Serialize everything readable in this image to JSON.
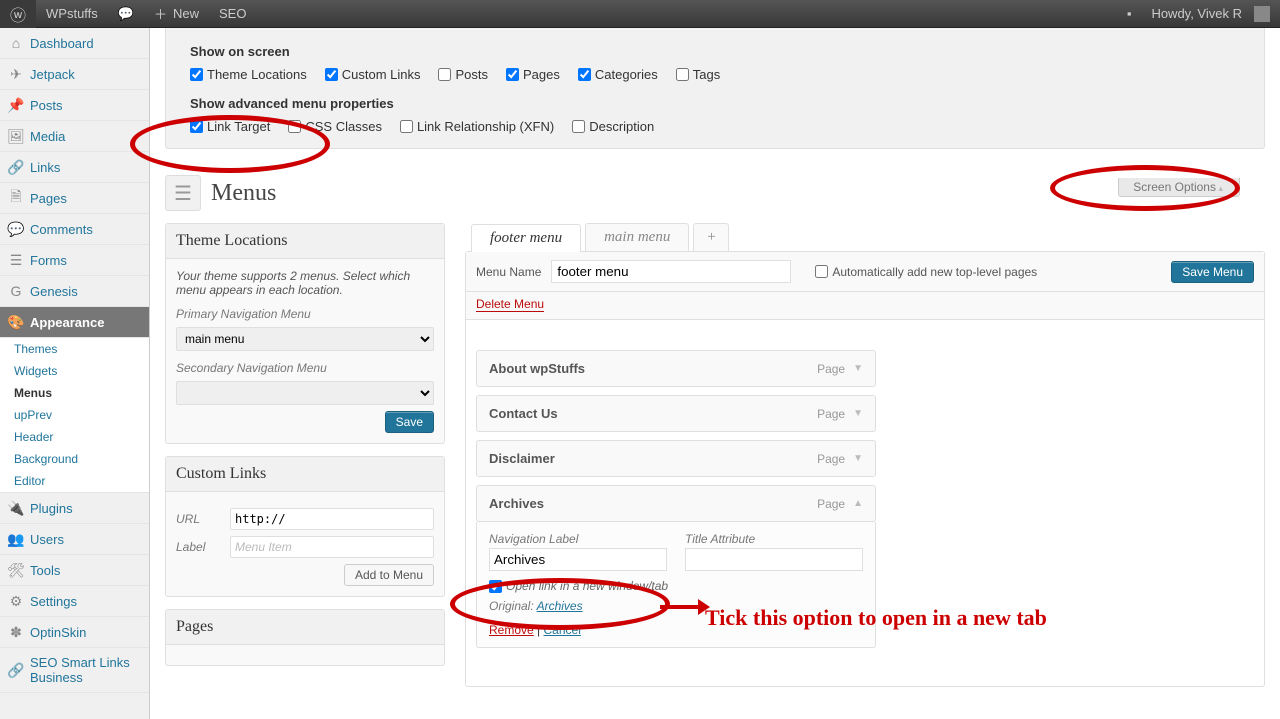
{
  "adminbar": {
    "site": "WPstuffs",
    "new": "New",
    "seo": "SEO",
    "howdy": "Howdy, Vivek R"
  },
  "sidebar": {
    "items": [
      {
        "label": "Dashboard",
        "icon": "⌂"
      },
      {
        "label": "Jetpack",
        "icon": "✈"
      },
      {
        "label": "Posts",
        "icon": "📌"
      },
      {
        "label": "Media",
        "icon": "🖼"
      },
      {
        "label": "Links",
        "icon": "🔗"
      },
      {
        "label": "Pages",
        "icon": "🗎"
      },
      {
        "label": "Comments",
        "icon": "💬"
      },
      {
        "label": "Forms",
        "icon": "☰"
      },
      {
        "label": "Genesis",
        "icon": "G"
      },
      {
        "label": "Appearance",
        "icon": "🎨",
        "current": true
      },
      {
        "label": "Plugins",
        "icon": "🔌"
      },
      {
        "label": "Users",
        "icon": "👥"
      },
      {
        "label": "Tools",
        "icon": "🛠"
      },
      {
        "label": "Settings",
        "icon": "⚙"
      },
      {
        "label": "OptinSkin",
        "icon": "✽"
      },
      {
        "label": "SEO Smart Links Business",
        "icon": "🔗"
      }
    ],
    "submenu": [
      "Themes",
      "Widgets",
      "Menus",
      "upPrev",
      "Header",
      "Background",
      "Editor"
    ]
  },
  "screenOptions": {
    "screenOptsBtn": "Screen Options",
    "showOnScreen": "Show on screen",
    "boxes": [
      {
        "label": "Theme Locations",
        "checked": true
      },
      {
        "label": "Custom Links",
        "checked": true
      },
      {
        "label": "Posts",
        "checked": false
      },
      {
        "label": "Pages",
        "checked": true
      },
      {
        "label": "Categories",
        "checked": true
      },
      {
        "label": "Tags",
        "checked": false
      }
    ],
    "advHeading": "Show advanced menu properties",
    "adv": [
      {
        "label": "Link Target",
        "checked": true
      },
      {
        "label": "CSS Classes",
        "checked": false
      },
      {
        "label": "Link Relationship (XFN)",
        "checked": false
      },
      {
        "label": "Description",
        "checked": false
      }
    ]
  },
  "heading": "Menus",
  "themeLocations": {
    "title": "Theme Locations",
    "hint": "Your theme supports 2 menus. Select which menu appears in each location.",
    "primaryLabel": "Primary Navigation Menu",
    "primaryValue": "main menu",
    "secondaryLabel": "Secondary Navigation Menu",
    "secondaryValue": "",
    "save": "Save"
  },
  "customLinks": {
    "title": "Custom Links",
    "urlLabel": "URL",
    "urlValue": "http://",
    "labelLabel": "Label",
    "labelPlaceholder": "Menu Item",
    "add": "Add to Menu"
  },
  "pagesBox": {
    "title": "Pages"
  },
  "menuTabs": {
    "tabs": [
      "footer menu",
      "main menu"
    ],
    "active": 0
  },
  "menuHeader": {
    "nameLabel": "Menu Name",
    "nameValue": "footer menu",
    "autoAdd": "Automatically add new top-level pages",
    "save": "Save Menu",
    "delete": "Delete Menu"
  },
  "menuItems": [
    {
      "title": "About wpStuffs",
      "type": "Page"
    },
    {
      "title": "Contact Us",
      "type": "Page"
    },
    {
      "title": "Disclaimer",
      "type": "Page"
    },
    {
      "title": "Archives",
      "type": "Page",
      "open": true
    }
  ],
  "openItem": {
    "navLabel": "Navigation Label",
    "navValue": "Archives",
    "titleAttr": "Title Attribute",
    "titleValue": "",
    "newTab": "Open link in a new window/tab",
    "originalLabel": "Original:",
    "originalLink": "Archives",
    "remove": "Remove",
    "cancel": "Cancel"
  },
  "annotation": {
    "text": "Tick this option to open in a new tab"
  }
}
